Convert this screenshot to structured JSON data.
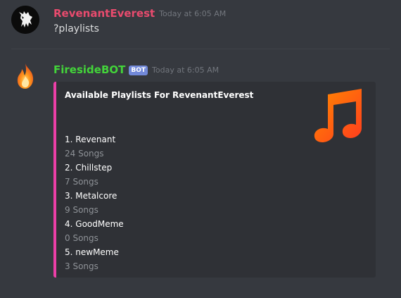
{
  "messages": [
    {
      "username": "RevenantEverest",
      "timestamp": "Today at 6:05 AM",
      "text": "?playlists",
      "avatar_icon": "wolf-howling-icon"
    },
    {
      "username": "FiresideBOT",
      "bot_tag": "BOT",
      "timestamp": "Today at 6:05 AM",
      "avatar_icon": "fire-emoji-icon",
      "embed": {
        "title": "Available Playlists For RevenantEverest",
        "accent_color": "#ec3fa7",
        "thumbnail_icon": "music-note-icon",
        "playlists": [
          {
            "name": "1. Revenant",
            "count": "24 Songs"
          },
          {
            "name": "2. Chillstep",
            "count": "7 Songs"
          },
          {
            "name": "3. Metalcore",
            "count": "9 Songs"
          },
          {
            "name": "4. GoodMeme",
            "count": "0 Songs"
          },
          {
            "name": "5. newMeme",
            "count": "3 Songs"
          }
        ]
      }
    }
  ],
  "colors": {
    "background": "#36393f",
    "user1_name": "#e94b6e",
    "bot_name": "#43b581",
    "bot_tag": "#7289da",
    "embed_bg": "#2f3136"
  }
}
